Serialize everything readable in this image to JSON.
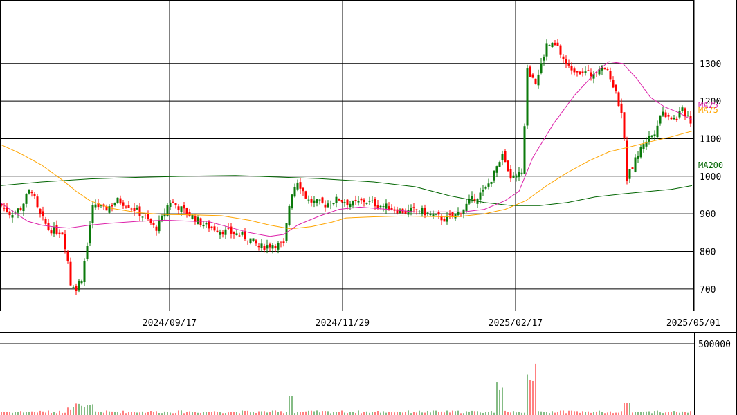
{
  "chart_data": {
    "type": "candlestick",
    "price_axis": {
      "ticks": [
        700,
        800,
        900,
        1000,
        1100,
        1200,
        1300
      ],
      "range": [
        600,
        1390
      ]
    },
    "date_axis": {
      "tick_labels": [
        "2024/09/17",
        "2024/11/29",
        "2025/02/17",
        "2025/05/01"
      ]
    },
    "ma_labels": [
      "MA25",
      "MA75",
      "MA200"
    ],
    "colors": {
      "up": "#0b7a0b",
      "down": "#ff0000",
      "ma25": "#dd22aa",
      "ma75": "#ffa500",
      "ma200": "#006400",
      "grid": "#000000"
    },
    "ma25": [
      [
        0,
        930
      ],
      [
        20,
        905
      ],
      [
        40,
        880
      ],
      [
        60,
        870
      ],
      [
        80,
        865
      ],
      [
        100,
        862
      ],
      [
        130,
        870
      ],
      [
        160,
        875
      ],
      [
        200,
        880
      ],
      [
        240,
        883
      ],
      [
        280,
        880
      ],
      [
        300,
        880
      ],
      [
        330,
        865
      ],
      [
        360,
        850
      ],
      [
        390,
        840
      ],
      [
        410,
        845
      ],
      [
        430,
        870
      ],
      [
        460,
        893
      ],
      [
        490,
        912
      ],
      [
        520,
        918
      ],
      [
        560,
        912
      ],
      [
        600,
        905
      ],
      [
        640,
        905
      ],
      [
        670,
        905
      ],
      [
        700,
        912
      ],
      [
        730,
        935
      ],
      [
        750,
        960
      ],
      [
        770,
        1050
      ],
      [
        800,
        1140
      ],
      [
        830,
        1215
      ],
      [
        860,
        1275
      ],
      [
        880,
        1305
      ],
      [
        900,
        1300
      ],
      [
        920,
        1260
      ],
      [
        940,
        1210
      ],
      [
        960,
        1185
      ],
      [
        980,
        1170
      ],
      [
        1000,
        1150
      ]
    ],
    "ma75": [
      [
        0,
        1085
      ],
      [
        30,
        1060
      ],
      [
        60,
        1030
      ],
      [
        90,
        990
      ],
      [
        110,
        960
      ],
      [
        130,
        935
      ],
      [
        160,
        915
      ],
      [
        200,
        903
      ],
      [
        240,
        898
      ],
      [
        280,
        897
      ],
      [
        320,
        895
      ],
      [
        360,
        883
      ],
      [
        390,
        870
      ],
      [
        420,
        860
      ],
      [
        450,
        866
      ],
      [
        480,
        878
      ],
      [
        500,
        889
      ],
      [
        540,
        892
      ],
      [
        580,
        894
      ],
      [
        620,
        893
      ],
      [
        660,
        892
      ],
      [
        700,
        900
      ],
      [
        730,
        912
      ],
      [
        760,
        935
      ],
      [
        790,
        975
      ],
      [
        820,
        1010
      ],
      [
        850,
        1040
      ],
      [
        880,
        1065
      ],
      [
        910,
        1078
      ],
      [
        940,
        1092
      ],
      [
        970,
        1105
      ],
      [
        1000,
        1120
      ]
    ],
    "ma200": [
      [
        0,
        975
      ],
      [
        60,
        985
      ],
      [
        130,
        993
      ],
      [
        200,
        997
      ],
      [
        270,
        1000
      ],
      [
        340,
        1002
      ],
      [
        400,
        998
      ],
      [
        460,
        994
      ],
      [
        540,
        985
      ],
      [
        600,
        972
      ],
      [
        650,
        948
      ],
      [
        700,
        930
      ],
      [
        740,
        922
      ],
      [
        780,
        922
      ],
      [
        820,
        930
      ],
      [
        860,
        945
      ],
      [
        900,
        953
      ],
      [
        940,
        960
      ],
      [
        970,
        965
      ],
      [
        1000,
        975
      ]
    ],
    "volume_axis": {
      "ticks": [
        500000
      ],
      "range": [
        0,
        560000
      ]
    }
  }
}
